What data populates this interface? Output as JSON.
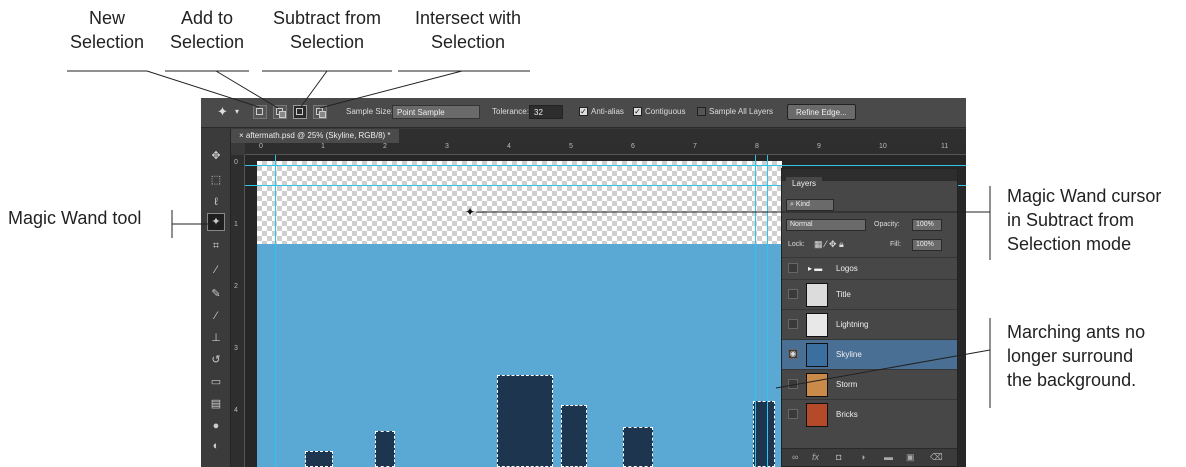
{
  "callouts": {
    "new_selection": [
      "New",
      "Selection"
    ],
    "add_to_selection": [
      "Add to",
      "Selection"
    ],
    "subtract_from_selection": [
      "Subtract from",
      "Selection"
    ],
    "intersect_with_selection": [
      "Intersect with",
      "Selection"
    ],
    "magic_wand_tool": "Magic Wand tool",
    "magic_wand_cursor": [
      "Magic Wand cursor",
      "in Subtract from",
      "Selection mode"
    ],
    "marching_ants": [
      "Marching ants no",
      "longer surround",
      "the background."
    ]
  },
  "options_bar": {
    "sample_size_label": "Sample Size:",
    "sample_size_value": "Point Sample",
    "tolerance_label": "Tolerance:",
    "tolerance_value": "32",
    "anti_alias_label": "Anti-alias",
    "anti_alias_checked": true,
    "contiguous_label": "Contiguous",
    "contiguous_checked": true,
    "sample_all_layers_label": "Sample All Layers",
    "sample_all_layers_checked": false,
    "refine_edge_label": "Refine Edge...",
    "check_glyph": "✓"
  },
  "document_tab": {
    "close": "×",
    "title": "aftermath.psd @ 25% (Skyline, RGB/8) *"
  },
  "ruler": {
    "h_numbers": [
      "0",
      "1",
      "2",
      "3",
      "4",
      "5",
      "6",
      "7",
      "8",
      "9",
      "10",
      "11"
    ],
    "v_numbers": [
      "0",
      "1",
      "2",
      "3",
      "4"
    ]
  },
  "layers_panel": {
    "tab": "Layers",
    "filter_kind": "Kind",
    "blend_mode": "Normal",
    "opacity_label": "Opacity:",
    "opacity_value": "100%",
    "lock_label": "Lock:",
    "fill_label": "Fill:",
    "fill_value": "100%",
    "layers": [
      {
        "name": "Logos",
        "group": true,
        "visible": false,
        "selected": false
      },
      {
        "name": "Title",
        "visible": false,
        "selected": false
      },
      {
        "name": "Lightning",
        "visible": false,
        "selected": false
      },
      {
        "name": "Skyline",
        "visible": true,
        "selected": true
      },
      {
        "name": "Storm",
        "visible": false,
        "selected": false
      },
      {
        "name": "Bricks",
        "visible": false,
        "selected": false
      }
    ],
    "footer_icons": [
      "link-icon",
      "fx-icon",
      "mask-icon",
      "adjustment-icon",
      "folder-icon",
      "new-layer-icon",
      "trash-icon"
    ],
    "footer_fx": "fx"
  },
  "colors": {
    "leader_line": "#222222",
    "sky": "#5aa8d4",
    "guide": "#2ec6e8",
    "selected_layer": "#4a6f95"
  }
}
